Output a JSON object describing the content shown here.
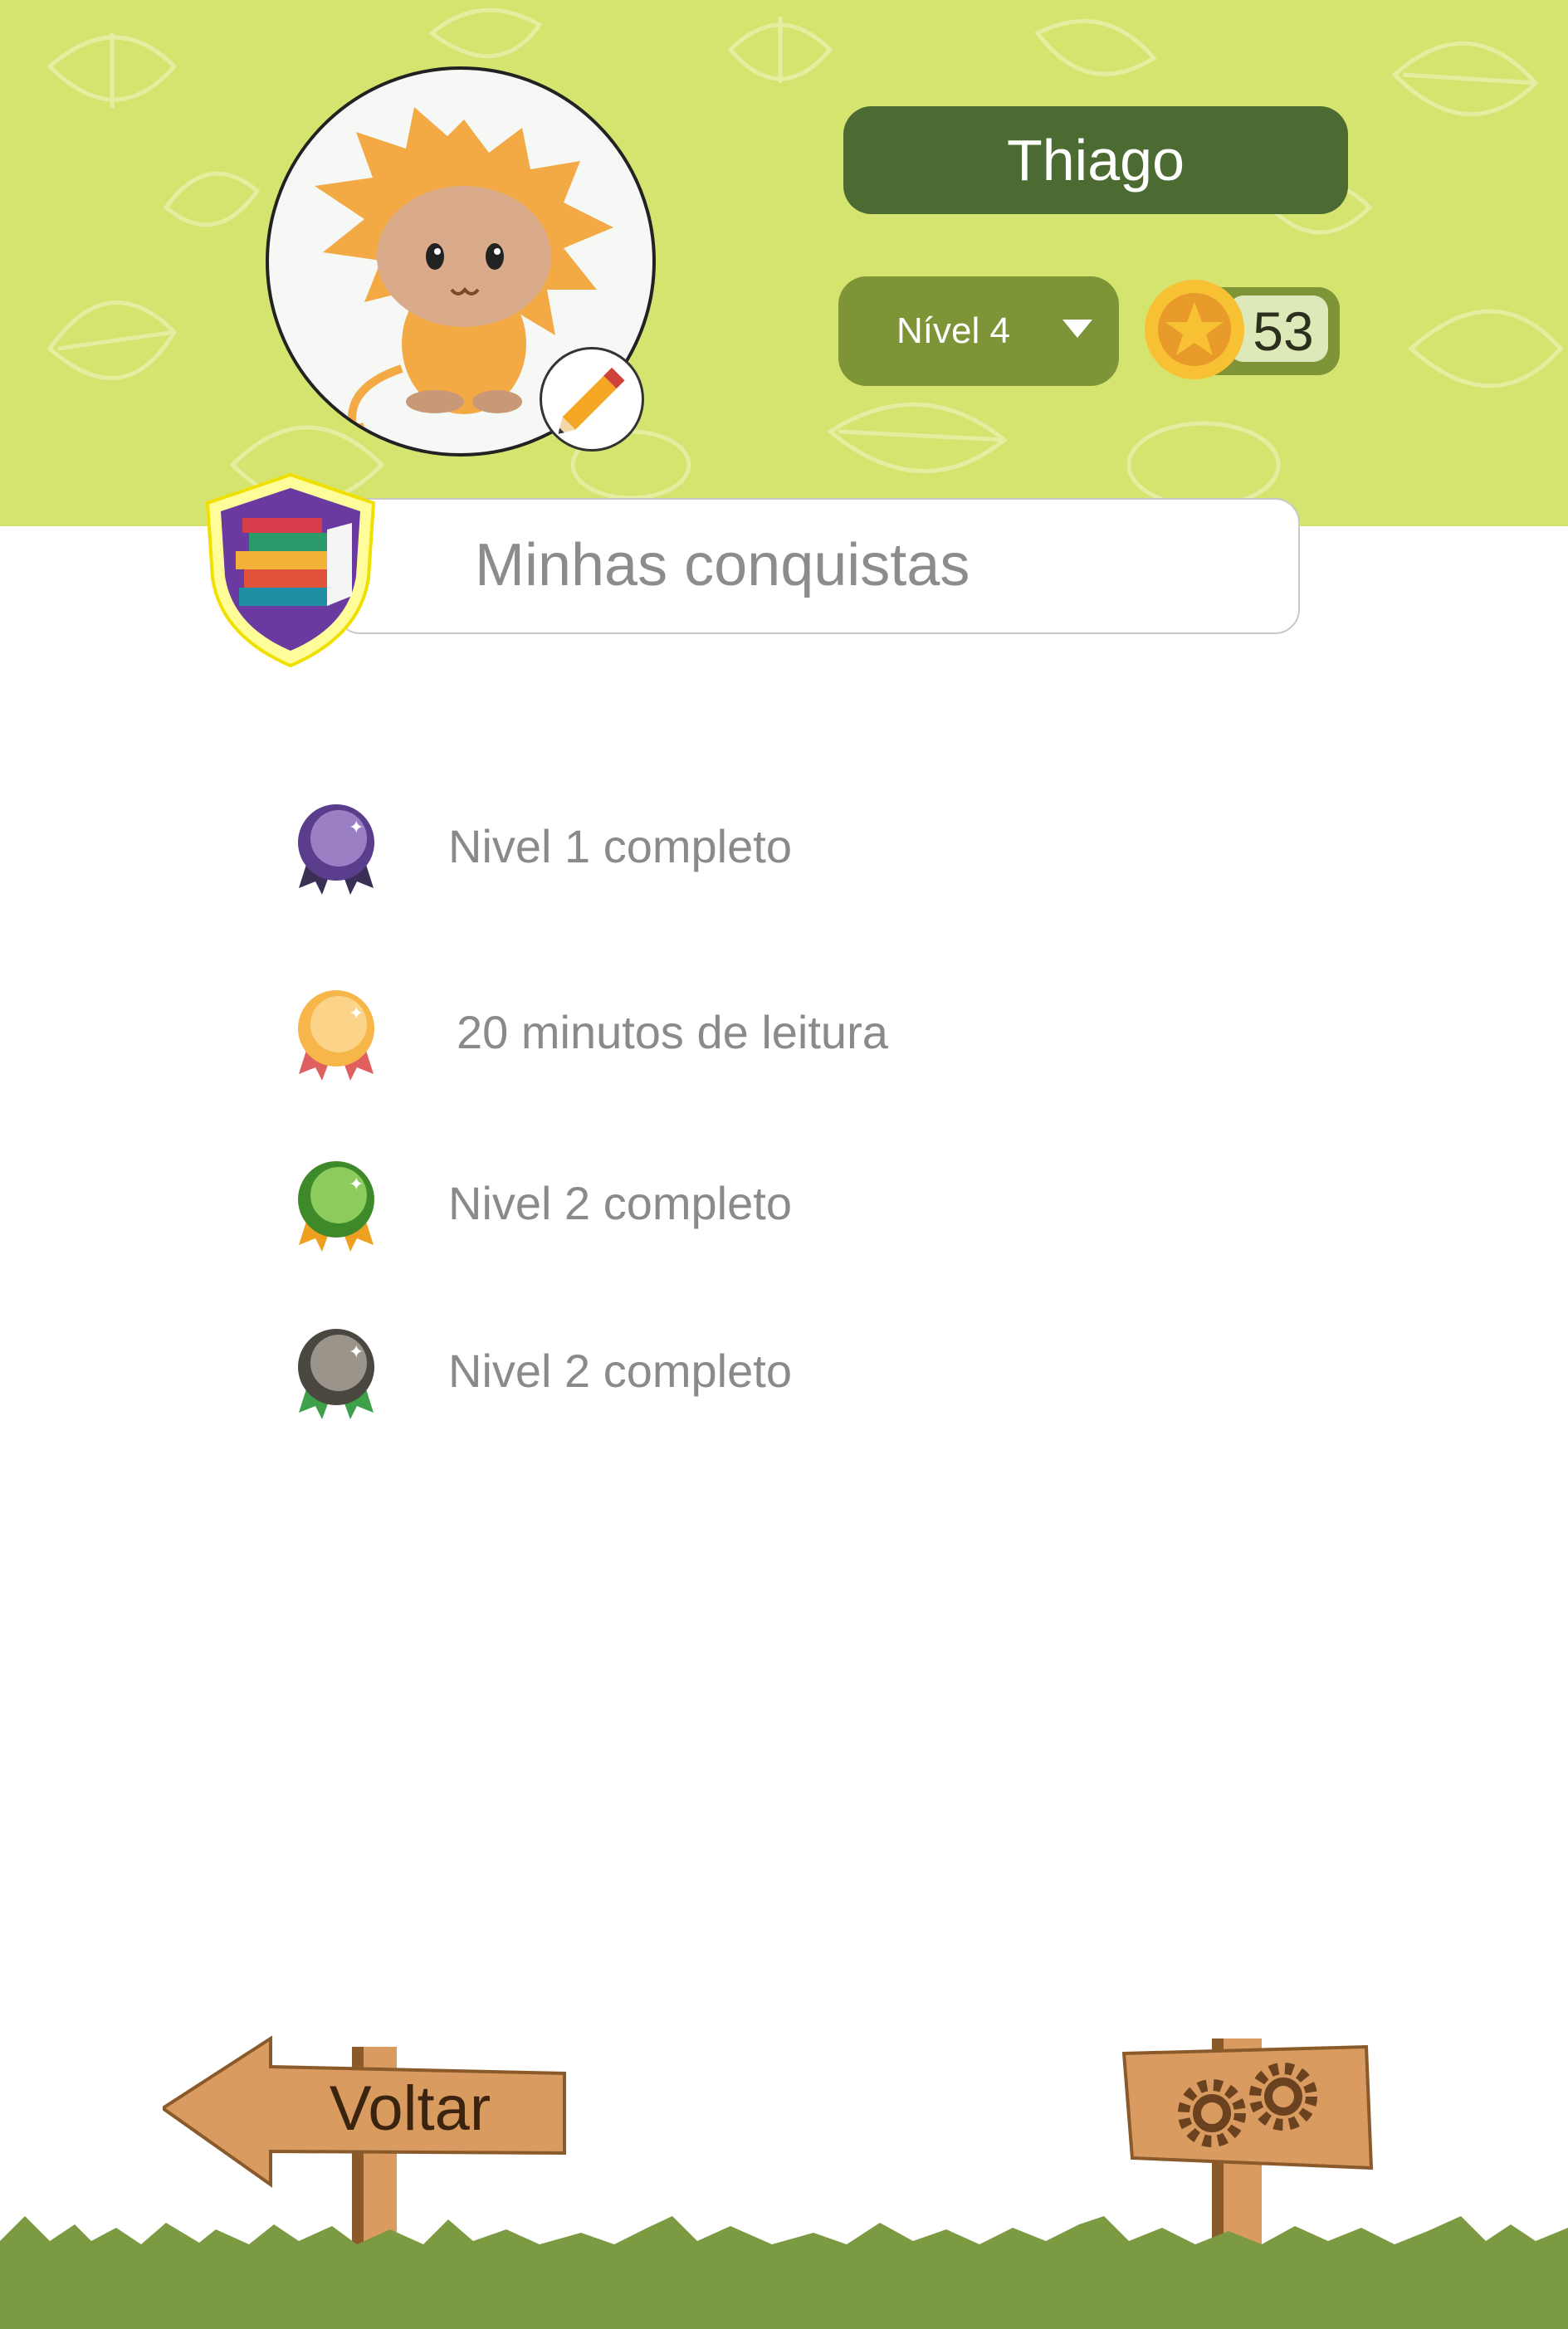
{
  "profile": {
    "name": "Thiago",
    "level_label": "Nível 4",
    "coins": "53"
  },
  "achievements": {
    "title": "Minhas conquistas",
    "items": [
      {
        "label": "Nivel 1 completo",
        "medal": "medal-purple-icon",
        "color": "#5a3d8c",
        "ribbon": "#3a2f55"
      },
      {
        "label": "20 minutos de leitura",
        "medal": "medal-gold-icon",
        "color": "#f6b64a",
        "ribbon": "#e06060"
      },
      {
        "label": "Nivel 2 completo",
        "medal": "medal-green-icon",
        "color": "#5fae3a",
        "ribbon": "#f0a020"
      },
      {
        "label": "Nivel 2 completo",
        "medal": "medal-gray-icon",
        "color": "#6e6a64",
        "ribbon": "#3fa04a"
      }
    ]
  },
  "navigation": {
    "back_label": "Voltar",
    "settings_icon": "gears-icon"
  },
  "colors": {
    "header_bg": "#d5e46f",
    "name_pill": "#4b6b32",
    "level_pill": "#7d9437",
    "sign_wood": "#d99b5f",
    "grass": "#7b9a42"
  }
}
